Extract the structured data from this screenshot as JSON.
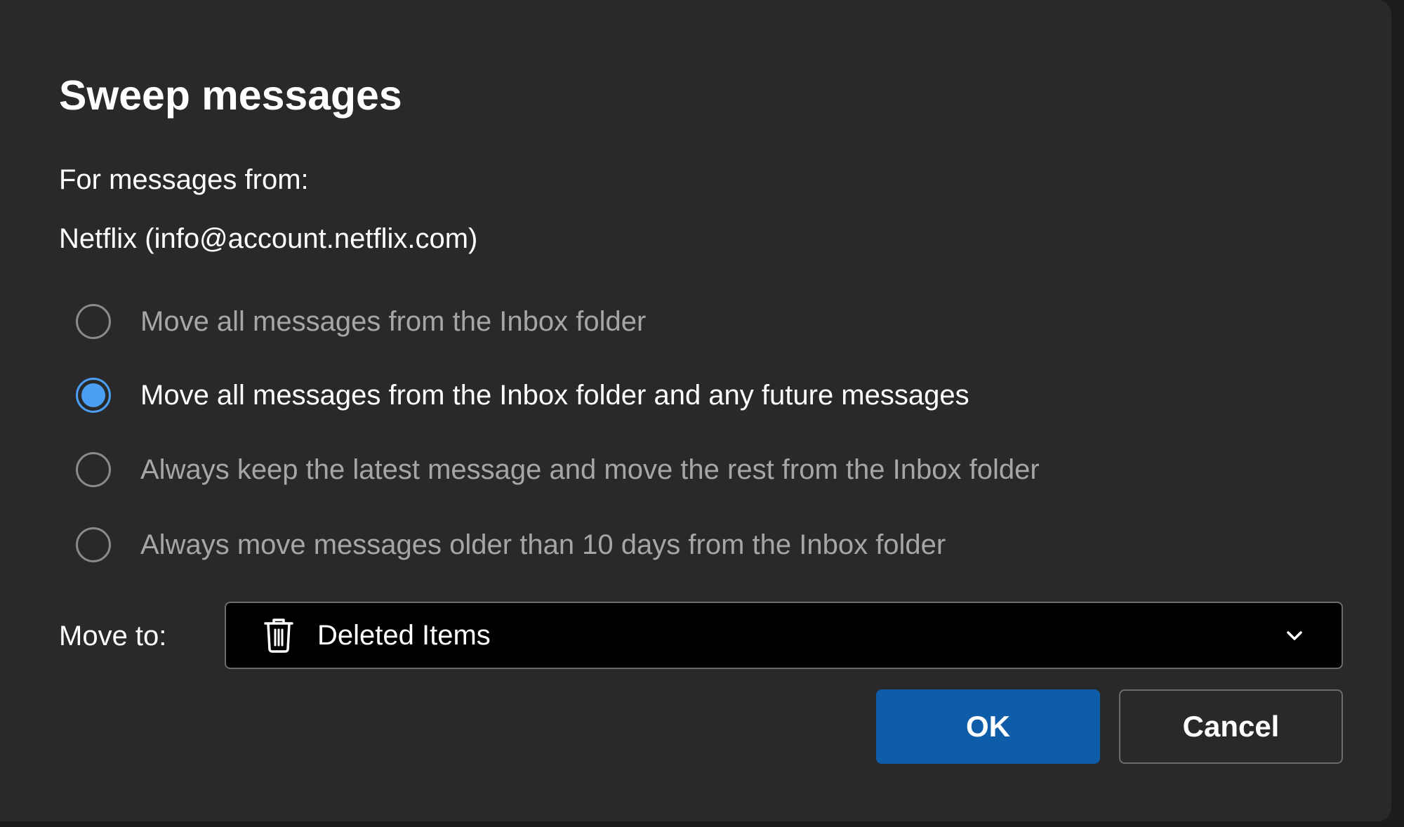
{
  "dialog": {
    "title": "Sweep messages",
    "subtitle": "For messages from:",
    "sender": "Netflix (info@account.netflix.com)"
  },
  "options": [
    {
      "label": "Move all messages from the Inbox folder",
      "checked": false
    },
    {
      "label": "Move all messages from the Inbox folder and any future messages",
      "checked": true
    },
    {
      "label": "Always keep the latest message and move the rest from the Inbox folder",
      "checked": false
    },
    {
      "label": "Always move messages older than 10 days from the Inbox folder",
      "checked": false
    }
  ],
  "move_to": {
    "label": "Move to:",
    "selected": "Deleted Items",
    "icon": "trash-icon"
  },
  "buttons": {
    "ok": "OK",
    "cancel": "Cancel"
  },
  "colors": {
    "dialog_bg": "#292929",
    "accent_radio": "#4a9ff5",
    "primary_button": "#0f5ca8",
    "dropdown_bg": "#000000"
  }
}
